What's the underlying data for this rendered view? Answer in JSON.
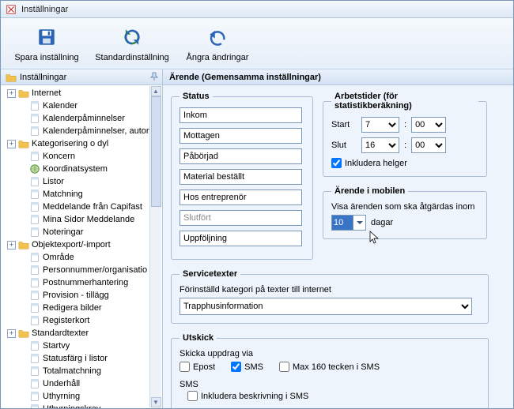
{
  "title": "Inställningar",
  "toolbar": {
    "save": "Spara inställning",
    "defaults": "Standardinställning",
    "undo": "Ångra ändringar"
  },
  "left_header": "Inställningar",
  "tree": {
    "items": [
      {
        "label": "Internet",
        "type": "folder",
        "expander": "plus",
        "depth": 1
      },
      {
        "label": "Kalender",
        "type": "page",
        "depth": 2
      },
      {
        "label": "Kalenderpåminnelser",
        "type": "page",
        "depth": 2
      },
      {
        "label": "Kalenderpåminnelser, auton",
        "type": "page",
        "depth": 2
      },
      {
        "label": "Kategorisering o dyl",
        "type": "folder",
        "expander": "plus",
        "depth": 1
      },
      {
        "label": "Koncern",
        "type": "page",
        "depth": 2
      },
      {
        "label": "Koordinatsystem",
        "type": "globe",
        "depth": 2
      },
      {
        "label": "Listor",
        "type": "page",
        "depth": 2
      },
      {
        "label": "Matchning",
        "type": "page",
        "depth": 2
      },
      {
        "label": "Meddelande från Capifast",
        "type": "page",
        "depth": 2
      },
      {
        "label": "Mina Sidor Meddelande",
        "type": "page",
        "depth": 2
      },
      {
        "label": "Noteringar",
        "type": "page",
        "depth": 2
      },
      {
        "label": "Objektexport/-import",
        "type": "folder",
        "expander": "plus",
        "depth": 1
      },
      {
        "label": "Område",
        "type": "page",
        "depth": 2
      },
      {
        "label": "Personnummer/organisatio",
        "type": "page",
        "depth": 2
      },
      {
        "label": "Postnummerhantering",
        "type": "page",
        "depth": 2
      },
      {
        "label": "Provision - tillägg",
        "type": "page",
        "depth": 2
      },
      {
        "label": "Redigera bilder",
        "type": "page",
        "depth": 2
      },
      {
        "label": "Registerkort",
        "type": "page",
        "depth": 2
      },
      {
        "label": "Standardtexter",
        "type": "folder",
        "expander": "plus",
        "depth": 1
      },
      {
        "label": "Startvy",
        "type": "page",
        "depth": 2
      },
      {
        "label": "Statusfärg i listor",
        "type": "page",
        "depth": 2
      },
      {
        "label": "Totalmatchning",
        "type": "page",
        "depth": 2
      },
      {
        "label": "Underhåll",
        "type": "page",
        "depth": 2
      },
      {
        "label": "Uthyrning",
        "type": "page",
        "depth": 2
      },
      {
        "label": "Uthyrningskrav",
        "type": "page",
        "depth": 2
      }
    ]
  },
  "right_header": "Ärende (Gemensamma inställningar)",
  "status": {
    "legend": "Status",
    "fields": [
      {
        "value": "Inkom",
        "disabled": false
      },
      {
        "value": "Mottagen",
        "disabled": false
      },
      {
        "value": "Påbörjad",
        "disabled": false
      },
      {
        "value": "Material beställt",
        "disabled": false
      },
      {
        "value": "Hos entreprenör",
        "disabled": false
      },
      {
        "value": "Slutfört",
        "disabled": true
      },
      {
        "value": "Uppföljning",
        "disabled": false
      }
    ]
  },
  "worktimes": {
    "legend": "Arbetstider (för statistikberäkning)",
    "start_label": "Start",
    "end_label": "Slut",
    "start_hour": "7",
    "start_min": "00",
    "end_hour": "16",
    "end_min": "00",
    "include_weekends": "Inkludera helger",
    "include_weekends_checked": true
  },
  "mobile": {
    "legend": "Ärende i mobilen",
    "desc": "Visa ärenden som ska åtgärdas inom",
    "days_value": "10",
    "days_suffix": "dagar"
  },
  "service": {
    "legend": "Servicetexter",
    "desc": "Förinställd kategori på texter till internet",
    "selected": "Trapphusinformation"
  },
  "utskick": {
    "legend": "Utskick",
    "send_via": "Skicka uppdrag via",
    "epost": "Epost",
    "epost_checked": false,
    "sms": "SMS",
    "sms_checked": true,
    "max160": "Max 160 tecken i SMS",
    "max160_checked": false,
    "sms_heading": "SMS",
    "include_desc": "Inkludera beskrivning i SMS",
    "include_desc_checked": false
  }
}
